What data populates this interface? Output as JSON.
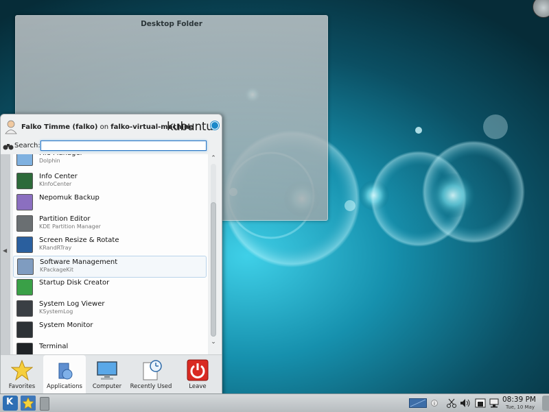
{
  "desktop": {
    "folder_title": "Desktop Folder"
  },
  "launcher": {
    "user_name": "Falko Timme (falko)",
    "user_on": " on ",
    "host": "falko-virtual-machine",
    "logo_text": "kubuntu",
    "search_label": "Search:",
    "search_value": "",
    "apps": [
      {
        "name": "File Manager",
        "sub": "Dolphin",
        "icon": "folder-icon"
      },
      {
        "name": "Info Center",
        "sub": "KInfoCenter",
        "icon": "info-center-icon"
      },
      {
        "name": "Nepomuk Backup",
        "sub": "",
        "icon": "nepomuk-icon"
      },
      {
        "name": "Partition Editor",
        "sub": "KDE Partition Manager",
        "icon": "partition-icon"
      },
      {
        "name": "Screen Resize & Rotate",
        "sub": "KRandRTray",
        "icon": "monitor-icon"
      },
      {
        "name": "Software Management",
        "sub": "KPackageKit",
        "icon": "package-icon"
      },
      {
        "name": "Startup Disk Creator",
        "sub": "",
        "icon": "disk-creator-icon"
      },
      {
        "name": "System Log Viewer",
        "sub": "KSystemLog",
        "icon": "log-viewer-icon"
      },
      {
        "name": "System Monitor",
        "sub": "",
        "icon": "system-monitor-icon"
      },
      {
        "name": "Terminal",
        "sub": "",
        "icon": "terminal-icon"
      }
    ],
    "selected_app": "Software Management",
    "tabs": [
      {
        "label": "Favorites",
        "icon": "star-icon"
      },
      {
        "label": "Applications",
        "icon": "applications-icon"
      },
      {
        "label": "Computer",
        "icon": "computer-icon"
      },
      {
        "label": "Recently Used",
        "icon": "recent-documents-icon"
      },
      {
        "label": "Leave",
        "icon": "power-icon"
      }
    ],
    "active_tab": "Applications"
  },
  "taskbar": {
    "time": "08:39 PM",
    "date": "Tue, 10 May",
    "accent": "#2e6fb4"
  },
  "colors": {
    "desktop_bg": "#0d3e4c",
    "selection_border": "#b9d3ea",
    "search_focus": "#2a76c4"
  }
}
